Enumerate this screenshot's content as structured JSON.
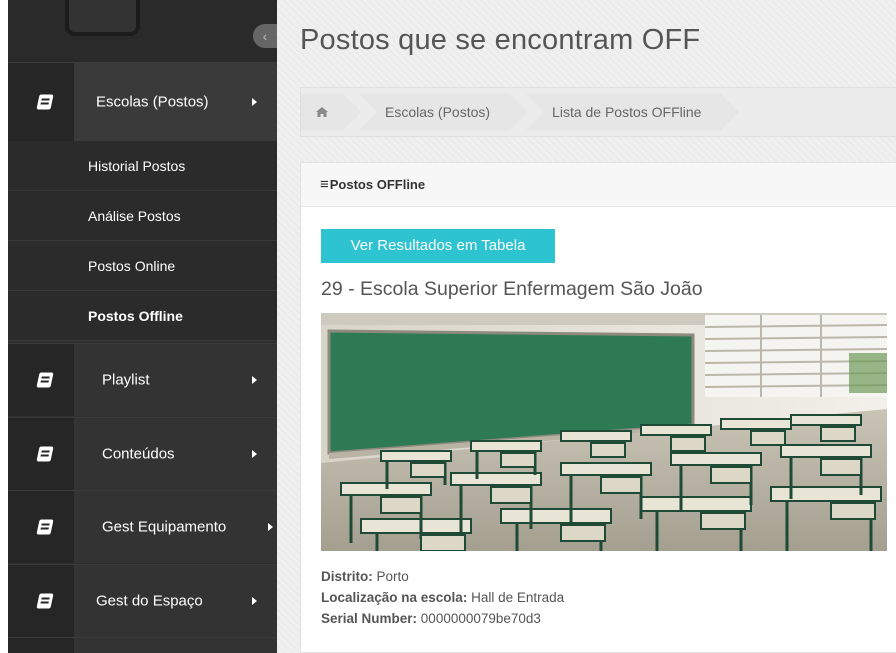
{
  "sidebar": {
    "collapse_icon": "chevron-left-icon",
    "menu": [
      {
        "label": "Escolas (Postos)",
        "icon": "book-icon",
        "open": true
      },
      {
        "label": "Playlist",
        "icon": "book-icon"
      },
      {
        "label": "Conteúdos",
        "icon": "book-icon"
      },
      {
        "label": "Gest Equipamento",
        "icon": "book-icon"
      },
      {
        "label": "Gest do Espaço",
        "icon": "book-icon"
      }
    ],
    "submenu": [
      {
        "label": "Historial Postos"
      },
      {
        "label": "Análise Postos"
      },
      {
        "label": "Postos Online"
      },
      {
        "label": "Postos Offline",
        "active": true
      }
    ]
  },
  "main": {
    "title": "Postos que se encontram OFF",
    "breadcrumb": {
      "home_icon": "home-icon",
      "items": [
        "Escolas (Postos)",
        "Lista de Postos OFFline"
      ]
    },
    "panel": {
      "header_icon": "≡",
      "header": "Postos OFFline",
      "button_label": "Ver Resultados em Tabela",
      "school_title": "29 - Escola Superior Enfermagem São João",
      "photo_icon": "classroom-photo",
      "fields": [
        {
          "label": "Distrito:",
          "value": "Porto"
        },
        {
          "label": "Localização na escola:",
          "value": "Hall de Entrada"
        },
        {
          "label": "Serial Number:",
          "value": "0000000079be70d3"
        }
      ]
    }
  },
  "colors": {
    "accent": "#2dc3d0",
    "sidebar": "#2f2f2f",
    "chalkboard": "#2e7a55"
  }
}
